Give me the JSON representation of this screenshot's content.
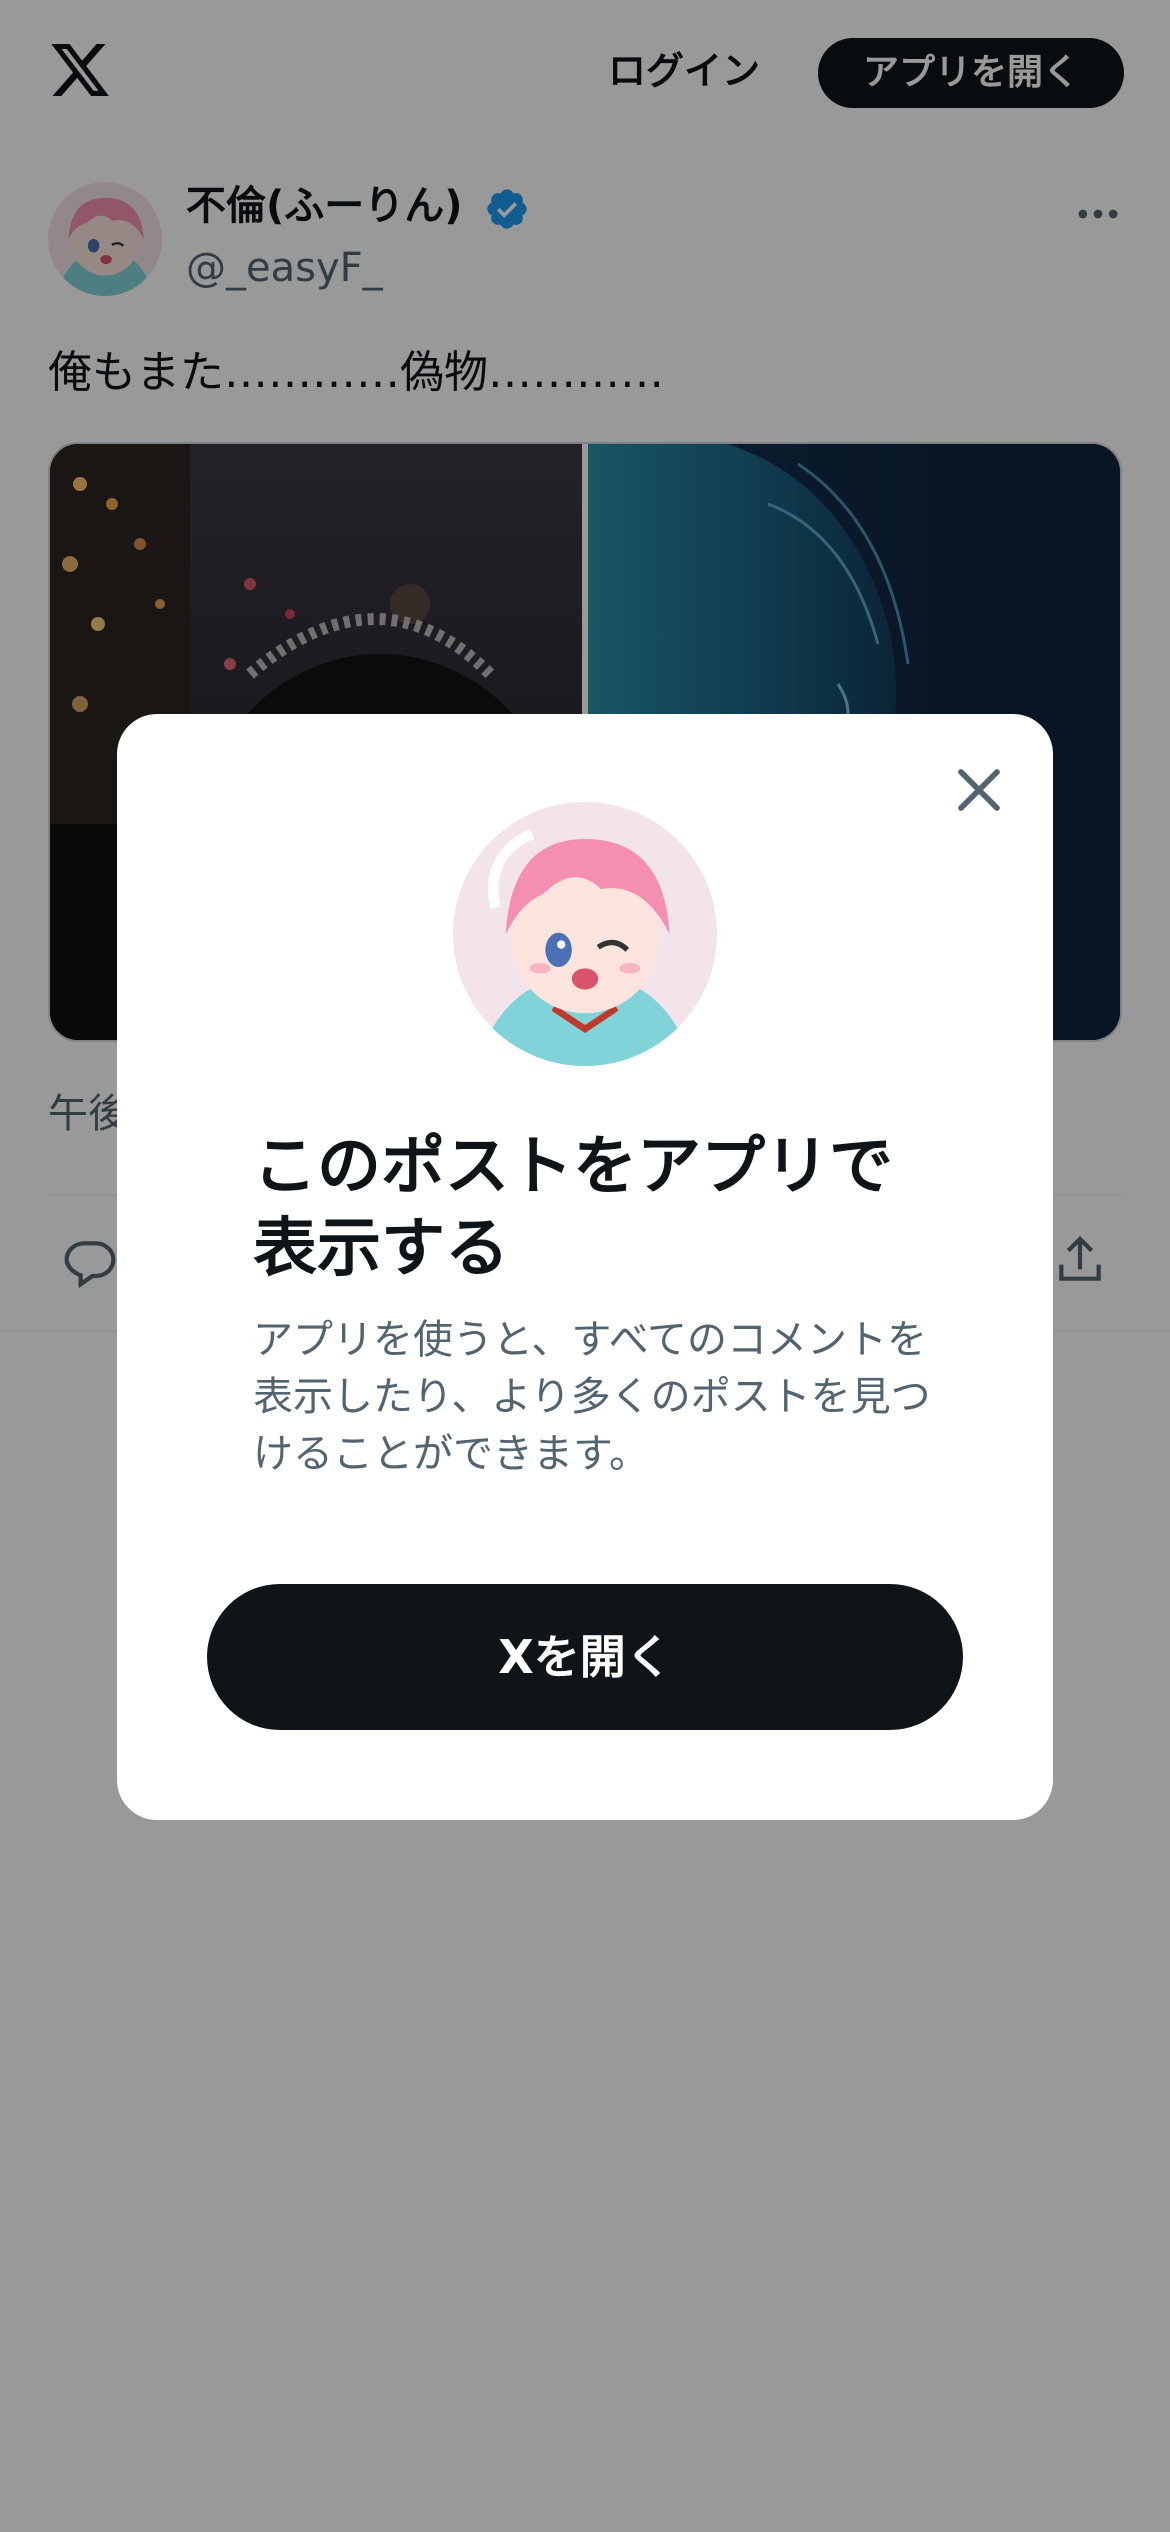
{
  "header": {
    "logo_icon": "x-logo-icon",
    "login_label": "ログイン",
    "open_app_label": "アプリを開く"
  },
  "post": {
    "display_name": "不倫(ふーりん)",
    "verified_icon": "verified-badge-icon",
    "handle": "@_easyF_",
    "text": "俺もまた…………偽物…………",
    "time_partial": "午後",
    "more_icon": "more-icon",
    "reply_icon": "reply-icon",
    "share_icon": "share-icon"
  },
  "modal": {
    "close_icon": "close-icon",
    "title": "このポストをアプリで表示する",
    "description": "アプリを使うと、すべてのコメントを表示したり、より多くのポストを見つけることができます。",
    "open_button": "Xを開く"
  },
  "colors": {
    "brand_dark": "#0f1419",
    "secondary_text": "#536471",
    "verified_blue": "#1d9bf0",
    "overlay": "rgba(0,0,0,0.40)"
  }
}
